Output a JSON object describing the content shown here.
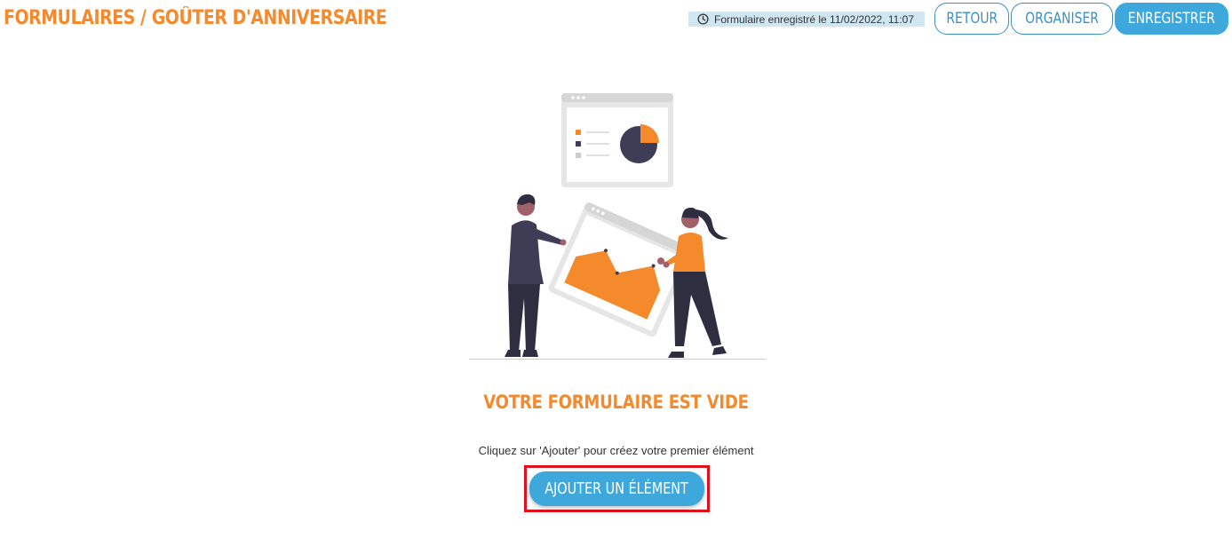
{
  "header": {
    "breadcrumb": "FORMULAIRES / GOÛTER D'ANNIVERSAIRE",
    "save_status": "Formulaire enregistré le 11/02/2022, 11:07",
    "status_icon": "clock-icon",
    "back_label": "RETOUR",
    "organize_label": "ORGANISER",
    "save_label": "ENREGISTRER"
  },
  "empty_state": {
    "illustration": "data-presentation-illustration",
    "title": "VOTRE FORMULAIRE EST VIDE",
    "description": "Cliquez sur 'Ajouter' pour créez votre premier élément",
    "add_label": "AJOUTER UN ÉLÉMENT"
  },
  "colors": {
    "accent_orange": "#f58a2c",
    "primary_blue": "#3ea7dc",
    "status_bg": "#cfe6f3",
    "highlight_red": "#e0111b",
    "figure_dark": "#3f3d56"
  }
}
